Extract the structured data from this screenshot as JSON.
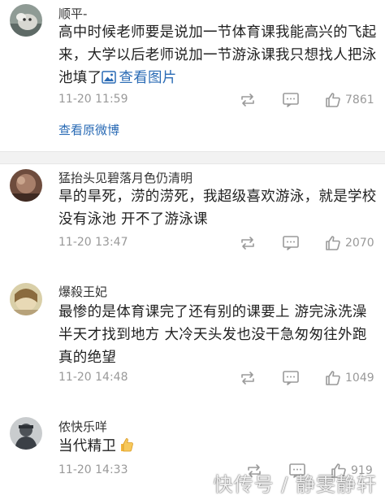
{
  "comments": [
    {
      "username": "顺平-",
      "content": "高中时候老师要是说加一节体育课我能高兴的飞起来，大学以后老师说加一节游泳课我只想找人把泳池填了",
      "image_link": "查看图片",
      "time": "11-20 11:59",
      "likes": "7861",
      "original_link": "查看原微博"
    },
    {
      "username": "猛抬头见碧落月色仍清明",
      "content": "旱的旱死，涝的涝死，我超级喜欢游泳，就是学校没有泳池 开不了游泳课",
      "time": "11-20 13:47",
      "likes": "2070"
    },
    {
      "username": "爆殺王妃",
      "content": "最惨的是体育课完了还有别的课要上 游完泳洗澡半天才找到地方 大冷天头发也没干急匆匆往外跑 真的绝望",
      "time": "11-20 14:48",
      "likes": "1049"
    },
    {
      "username": "侬快乐咩",
      "content": "当代精卫",
      "emoji": "thumbs-up-emoji",
      "time": "11-20 14:33",
      "likes": "919"
    }
  ],
  "icons": {
    "repost": "repost-icon",
    "comment": "comment-icon",
    "like": "like-icon",
    "image": "image-icon"
  },
  "colors": {
    "link": "#2a6bb5",
    "meta": "#999999",
    "separator": "#f2f2f2"
  },
  "watermark": "快传号 / 静雯静轩"
}
